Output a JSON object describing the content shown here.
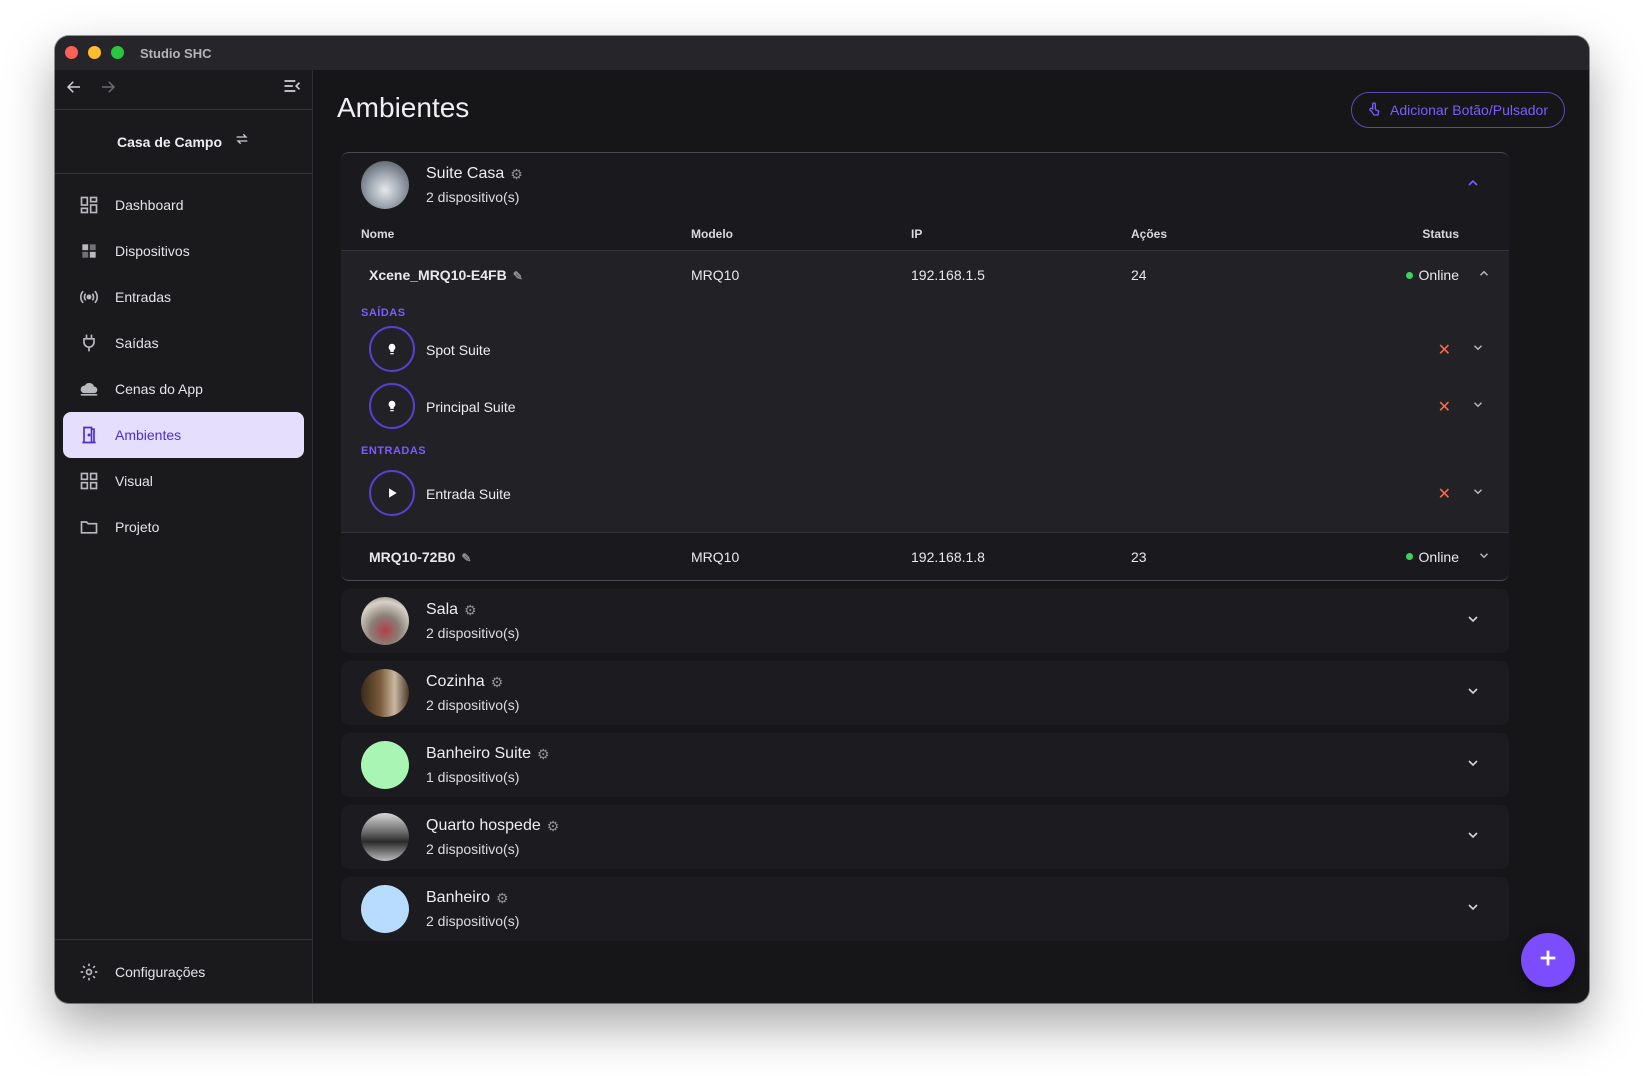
{
  "window": {
    "title": "Studio SHC"
  },
  "sidebar": {
    "project": "Casa de Campo",
    "items": [
      {
        "label": "Dashboard",
        "icon": "dashboard-icon"
      },
      {
        "label": "Dispositivos",
        "icon": "devices-icon"
      },
      {
        "label": "Entradas",
        "icon": "broadcast-icon"
      },
      {
        "label": "Saídas",
        "icon": "plug-icon"
      },
      {
        "label": "Cenas do App",
        "icon": "cloud-icon"
      },
      {
        "label": "Ambientes",
        "icon": "door-icon",
        "active": true
      },
      {
        "label": "Visual",
        "icon": "grid-icon"
      },
      {
        "label": "Projeto",
        "icon": "folder-icon"
      }
    ],
    "settings_label": "Configurações"
  },
  "main": {
    "title": "Ambientes",
    "add_button": "Adicionar Botão/Pulsador",
    "colors": {
      "accent": "#7c5cff",
      "online": "#3bd35a",
      "remove": "#ff6a4d"
    }
  },
  "rooms": [
    {
      "name": "Suite Casa",
      "count": "2 dispositivo(s)",
      "expanded": true,
      "table_headers": {
        "name": "Nome",
        "model": "Modelo",
        "ip": "IP",
        "actions": "Ações",
        "status": "Status"
      },
      "devices": [
        {
          "name": "Xcene_MRQ10-E4FB",
          "model": "MRQ10",
          "ip": "192.168.1.5",
          "actions": "24",
          "status": "Online",
          "expanded": true,
          "outputs_label": "SAÍDAS",
          "outputs": [
            {
              "label": "Spot Suite"
            },
            {
              "label": "Principal Suite"
            }
          ],
          "inputs_label": "ENTRADAS",
          "inputs": [
            {
              "label": "Entrada Suite"
            }
          ]
        },
        {
          "name": "MRQ10-72B0",
          "model": "MRQ10",
          "ip": "192.168.1.8",
          "actions": "23",
          "status": "Online"
        }
      ]
    },
    {
      "name": "Sala",
      "count": "2 dispositivo(s)"
    },
    {
      "name": "Cozinha",
      "count": "2 dispositivo(s)"
    },
    {
      "name": "Banheiro Suite",
      "count": "1 dispositivo(s)",
      "avatar_color": "#a8f5b4"
    },
    {
      "name": "Quarto hospede",
      "count": "2 dispositivo(s)"
    },
    {
      "name": "Banheiro",
      "count": "2 dispositivo(s)",
      "avatar_color": "#b7dcff"
    }
  ]
}
